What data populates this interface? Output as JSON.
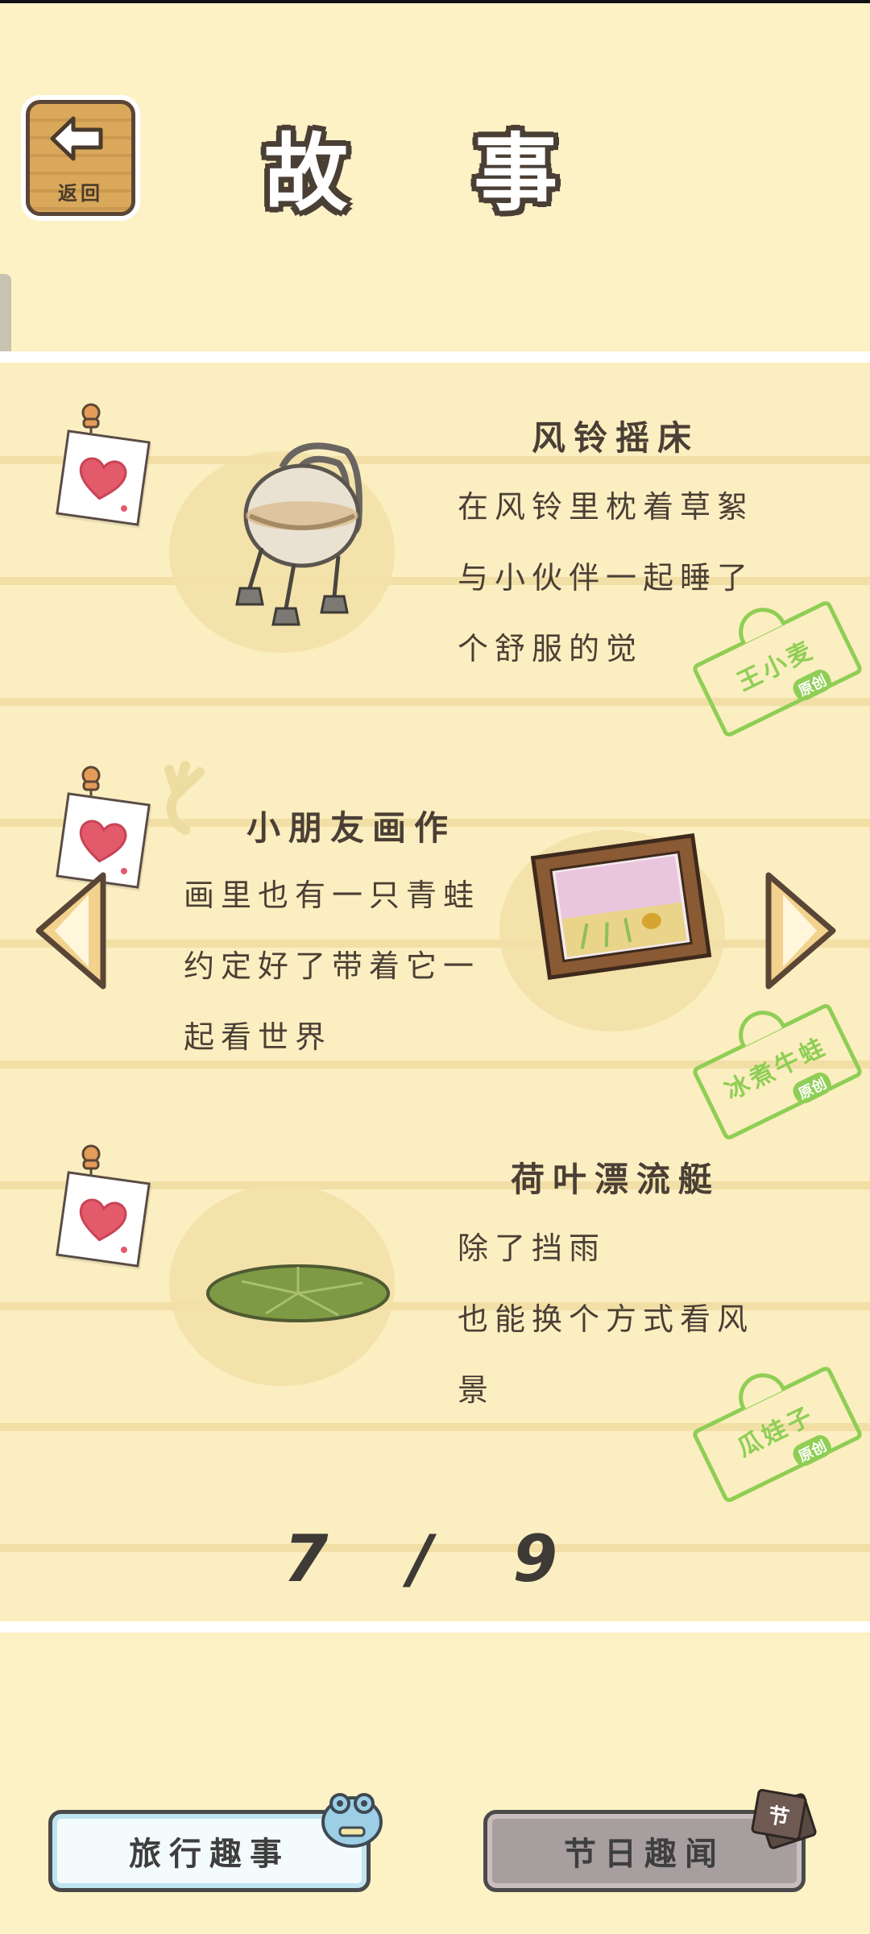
{
  "header": {
    "title": "故 事",
    "back_label": "返回"
  },
  "stories": [
    {
      "title": "风铃摇床",
      "lines": [
        "在风铃里枕着草絮",
        "与小伙伴一起睡了",
        "个舒服的觉"
      ],
      "stamp_name": "王小麦",
      "stamp_sub": "原创"
    },
    {
      "title": "小朋友画作",
      "lines": [
        "画里也有一只青蛙",
        "约定好了带着它一",
        "起看世界"
      ],
      "stamp_name": "冰煮牛蛙",
      "stamp_sub": "原创"
    },
    {
      "title": "荷叶漂流艇",
      "lines": [
        "除了挡雨",
        "也能换个方式看风",
        "景"
      ],
      "stamp_name": "瓜娃子",
      "stamp_sub": "原创"
    }
  ],
  "pagination": {
    "text": "7 / 9"
  },
  "tabs": {
    "travel_label": "旅行趣事",
    "festival_label": "节日趣闻",
    "festival_icon_text": "节"
  },
  "colors": {
    "background": "#fcefc0",
    "stamp_green": "#8fce55",
    "wood": "#d9a85a",
    "heart": "#e35a6a"
  }
}
